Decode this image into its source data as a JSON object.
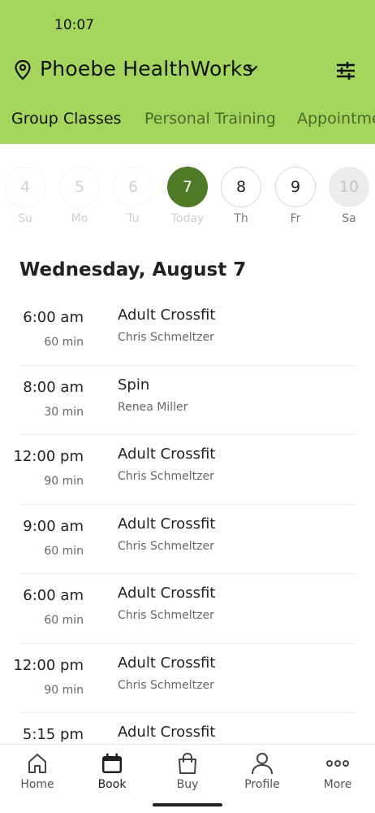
{
  "status_bar": {
    "time": "10:07"
  },
  "header": {
    "gym_name": "Phoebe HealthWorks",
    "icons": {
      "location": "location-pin-icon",
      "dropdown": "chevron-down-icon",
      "filter": "sliders-icon"
    },
    "background_color": "#a4d65e"
  },
  "tabs": [
    {
      "label": "Group Classes",
      "active": true
    },
    {
      "label": "Personal Training",
      "active": false
    },
    {
      "label": "Appointments",
      "active": false
    }
  ],
  "days": [
    {
      "number": "4",
      "label": "Su",
      "state": "past"
    },
    {
      "number": "5",
      "label": "Mo",
      "state": "past"
    },
    {
      "number": "6",
      "label": "Tu",
      "state": "past"
    },
    {
      "number": "7",
      "label": "Today",
      "state": "selected"
    },
    {
      "number": "8",
      "label": "Th",
      "state": "future"
    },
    {
      "number": "9",
      "label": "Fr",
      "state": "future"
    },
    {
      "number": "10",
      "label": "Sa",
      "state": "disabled"
    }
  ],
  "date_heading": "Wednesday, August 7",
  "classes": [
    {
      "time": "6:00 am",
      "duration": "60 min",
      "name": "Adult Crossfit",
      "instructor": "Chris Schmeltzer"
    },
    {
      "time": "8:00 am",
      "duration": "30 min",
      "name": "Spin",
      "instructor": "Renea Miller"
    },
    {
      "time": "12:00 pm",
      "duration": "90 min",
      "name": "Adult Crossfit",
      "instructor": "Chris Schmeltzer"
    },
    {
      "time": "9:00 am",
      "duration": "60 min",
      "name": "Adult Crossfit",
      "instructor": "Chris Schmeltzer"
    },
    {
      "time": "6:00 am",
      "duration": "60 min",
      "name": "Adult Crossfit",
      "instructor": "Chris Schmeltzer"
    },
    {
      "time": "12:00 pm",
      "duration": "90 min",
      "name": "Adult Crossfit",
      "instructor": "Chris Schmeltzer"
    },
    {
      "time": "5:15 pm",
      "duration": "",
      "name": "Adult Crossfit",
      "instructor": ""
    }
  ],
  "bottom_nav": [
    {
      "label": "Home",
      "icon": "home-icon",
      "active": false
    },
    {
      "label": "Book",
      "icon": "calendar-icon",
      "active": true
    },
    {
      "label": "Buy",
      "icon": "shopping-bag-icon",
      "active": false
    },
    {
      "label": "Profile",
      "icon": "person-icon",
      "active": false
    },
    {
      "label": "More",
      "icon": "more-dots-icon",
      "active": false
    }
  ],
  "colors": {
    "accent": "#a4d65e",
    "selected_day": "#4f7a28",
    "tab_inactive": "#4a6a2a"
  }
}
